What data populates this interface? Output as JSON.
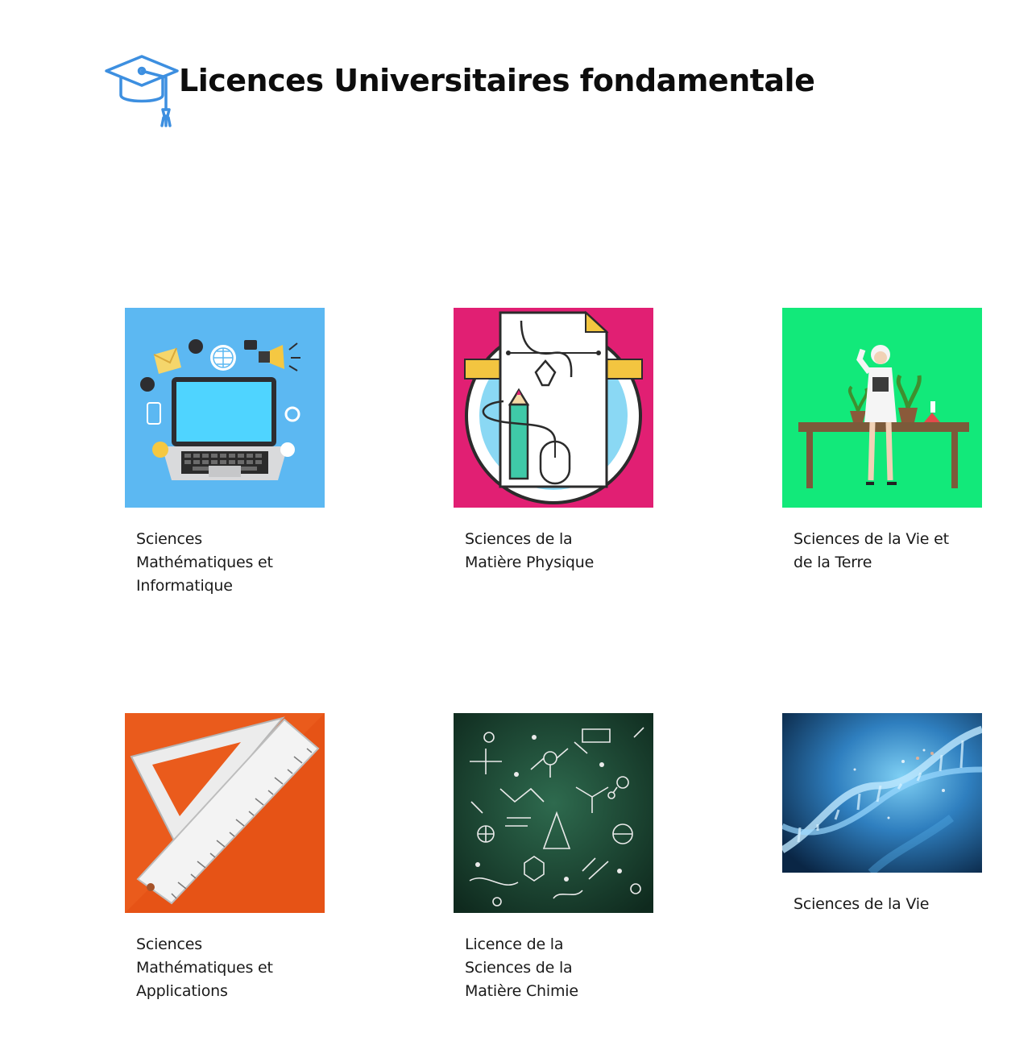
{
  "page": {
    "title": "Licences Universitaires fondamentale",
    "title_icon": "graduation-cap-icon",
    "accent_color": "#3d8fe0"
  },
  "cards": [
    {
      "label": "Sciences Mathématiques et Informatique",
      "image": "laptop-network-illustration",
      "bg_color": "#5cb8f2"
    },
    {
      "label": "Sciences de la Matière Physique",
      "image": "design-tools-illustration",
      "bg_color": "#e11f73"
    },
    {
      "label": "Sciences de la Vie et de la Terre",
      "image": "scientist-lab-illustration",
      "bg_color": "#12e97a"
    },
    {
      "label": "Sciences Mathématiques et Applications",
      "image": "ruler-set-square-illustration",
      "bg_color": "#ea5b1c"
    },
    {
      "label": "Licence de la Sciences de la Matière Chimie",
      "image": "chemistry-chalkboard-illustration",
      "bg_color": "#16382a"
    },
    {
      "label": "Sciences de la Vie",
      "image": "dna-helix-photo",
      "bg_color": "#1d5e95"
    }
  ]
}
